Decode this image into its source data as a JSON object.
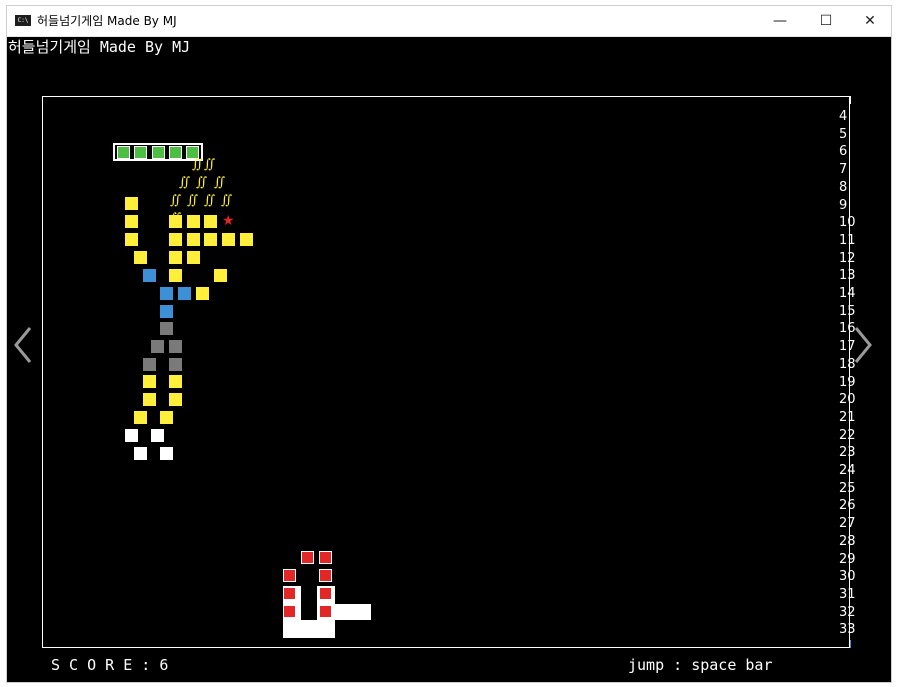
{
  "window": {
    "title": "허들넘기게임 Made By MJ",
    "icon_text": "C:\\",
    "minimize": "—",
    "maximize": "☐",
    "close": "✕"
  },
  "console": {
    "title_line": "허들넘기게임 Made By MJ"
  },
  "rows": [
    "4",
    "5",
    "6",
    "7",
    "8",
    "9",
    "10",
    "11",
    "12",
    "13",
    "14",
    "15",
    "16",
    "17",
    "18",
    "19",
    "20",
    "21",
    "22",
    "23",
    "24",
    "25",
    "26",
    "27",
    "28",
    "29",
    "30",
    "31",
    "32",
    "33"
  ],
  "hair_glyphs": "∬",
  "status": {
    "score_label": "S C O R E : 6",
    "help": "jump : space bar"
  },
  "colors": {
    "yellow": "#ffef3a",
    "blue": "#3d8fd6",
    "gray": "#7a7a7a",
    "green": "#4cbf43",
    "red": "#e32626",
    "background": "#000000"
  }
}
